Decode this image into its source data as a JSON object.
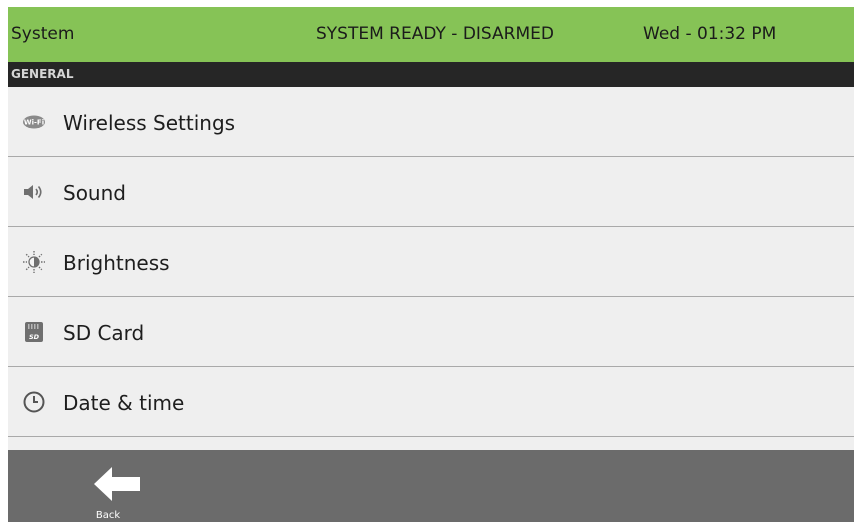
{
  "status_bar": {
    "title": "System",
    "state": "SYSTEM READY - DISARMED",
    "datetime": "Wed - 01:32 PM",
    "background_color": "#86c356"
  },
  "section": {
    "label": "GENERAL"
  },
  "menu": {
    "items": [
      {
        "label": "Wireless Settings",
        "icon": "wifi-icon"
      },
      {
        "label": "Sound",
        "icon": "speaker-icon"
      },
      {
        "label": "Brightness",
        "icon": "brightness-icon"
      },
      {
        "label": "SD Card",
        "icon": "sd-card-icon"
      },
      {
        "label": "Date & time",
        "icon": "clock-icon"
      }
    ]
  },
  "bottom_bar": {
    "back_label": "Back",
    "back_icon": "back-arrow-icon"
  }
}
